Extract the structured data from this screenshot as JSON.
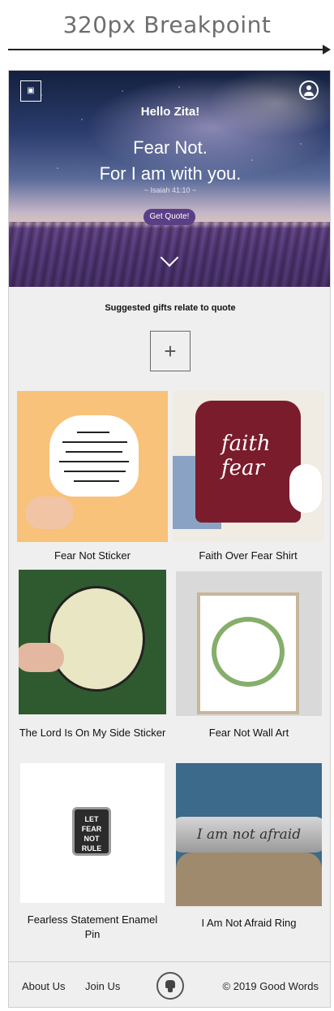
{
  "breakpoint": {
    "title": "320px Breakpoint"
  },
  "hero": {
    "greeting": "Hello Zita!",
    "quote_line1": "Fear Not.",
    "quote_line2": "For I am with you.",
    "reference": "~ Isaiah 41:10 ~",
    "button_label": "Get Quote!"
  },
  "suggested": {
    "heading": "Suggested gifts relate to quote",
    "add_symbol": "+"
  },
  "products": [
    {
      "name": "Fear Not Sticker"
    },
    {
      "name": "Faith Over Fear Shirt"
    },
    {
      "name": "The Lord Is On My Side Sticker"
    },
    {
      "name": "Fear Not Wall Art"
    },
    {
      "name": "Fearless Statement Enamel Pin"
    },
    {
      "name": "I Am Not Afraid Ring"
    }
  ],
  "footer": {
    "about": "About Us",
    "join": "Join Us",
    "copyright": "© 2019 Good Words"
  },
  "colors": {
    "button": "#5b3f86",
    "page_bg": "#efefef"
  },
  "icons": [
    "logo-icon",
    "user-icon",
    "chevron-down-icon",
    "plus-icon",
    "github-icon"
  ]
}
